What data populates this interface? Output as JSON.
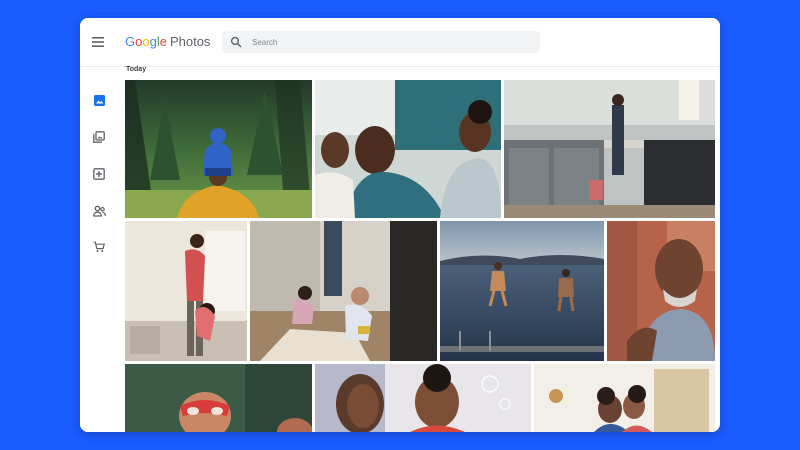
{
  "app": {
    "logo_letters": [
      "G",
      "o",
      "o",
      "g",
      "l",
      "e"
    ],
    "logo_product": "Photos"
  },
  "search": {
    "placeholder": "Search",
    "value": ""
  },
  "icons": {
    "menu": "hamburger-menu-icon",
    "search": "search-icon",
    "sidebar": [
      "photos-icon",
      "albums-icon",
      "utilities-icon",
      "sharing-icon",
      "print-store-icon"
    ]
  },
  "section": {
    "label": "Today"
  },
  "photos": [
    "forest-hike-photo",
    "family-couch-photo",
    "kitchen-photo",
    "mother-child-photo",
    "kids-floor-photo",
    "lake-jump-photo",
    "smiling-man-photo",
    "masked-child-photo",
    "child-bubbles-photo",
    "hug-photo"
  ],
  "colors": {
    "page_background": "#1a5cff",
    "accent": "#1a73e8",
    "icon": "#5f6368"
  }
}
